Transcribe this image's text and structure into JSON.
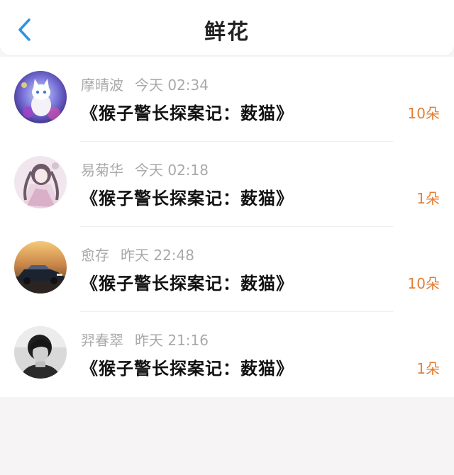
{
  "header": {
    "title": "鲜花",
    "back_icon": "chevron-left-icon",
    "accent_color": "#2b94e4"
  },
  "list": {
    "items": [
      {
        "name": "摩晴波",
        "time": "今天 02:34",
        "book": "《猴子警长探案记：薮猫》",
        "count": "10朵",
        "avatar": "white-cat-avatar"
      },
      {
        "name": "易菊华",
        "time": "今天 02:18",
        "book": "《猴子警长探案记：薮猫》",
        "count": "1朵",
        "avatar": "anime-girl-avatar"
      },
      {
        "name": "愈存",
        "time": "昨天 22:48",
        "book": "《猴子警长探案记：薮猫》",
        "count": "10朵",
        "avatar": "car-avatar"
      },
      {
        "name": "羿春翠",
        "time": "昨天 21:16",
        "book": "《猴子警长探案记：薮猫》",
        "count": "1朵",
        "avatar": "person-avatar"
      }
    ]
  },
  "colors": {
    "count": "#e27d34",
    "meta": "#a9a9a9",
    "background": "#f6f4f5"
  }
}
